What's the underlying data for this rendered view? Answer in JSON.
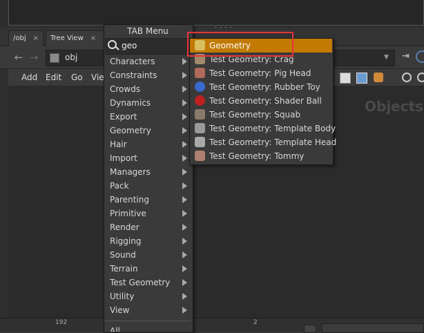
{
  "network_pane": {
    "tabs": [
      {
        "label": "/obj",
        "close": "×"
      },
      {
        "label": "Tree View",
        "close": "×"
      }
    ],
    "path": "obj",
    "menu": [
      "Add",
      "Edit",
      "Go",
      "View"
    ],
    "watermark": "Objects",
    "status_left": "192",
    "status_mid": "2"
  },
  "tab_menu": {
    "title": "TAB Menu",
    "search_value": "geo",
    "categories": [
      "Characters",
      "Constraints",
      "Crowds",
      "Dynamics",
      "Export",
      "Geometry",
      "Hair",
      "Import",
      "Managers",
      "Pack",
      "Parenting",
      "Primitive",
      "Render",
      "Rigging",
      "Sound",
      "Terrain",
      "Test Geometry",
      "Utility",
      "View"
    ],
    "more_item": "All"
  },
  "search_results": [
    {
      "label": "Geometry",
      "icon": "geometry-node-icon",
      "highlighted": true
    },
    {
      "label": "Test Geometry: Crag",
      "icon": "crag-icon"
    },
    {
      "label": "Test Geometry: Pig Head",
      "icon": "pig-head-icon"
    },
    {
      "label": "Test Geometry: Rubber Toy",
      "icon": "rubber-toy-icon"
    },
    {
      "label": "Test Geometry: Shader Ball",
      "icon": "shader-ball-icon"
    },
    {
      "label": "Test Geometry: Squab",
      "icon": "squab-icon"
    },
    {
      "label": "Test Geometry: Template Body",
      "icon": "template-body-icon"
    },
    {
      "label": "Test Geometry: Template Head",
      "icon": "template-head-icon"
    },
    {
      "label": "Test Geometry: Tommy",
      "icon": "tommy-icon"
    }
  ],
  "colors": {
    "highlight": "#c27a04",
    "annotation_box": "#e8343a",
    "panel": "#3a3a3a"
  }
}
